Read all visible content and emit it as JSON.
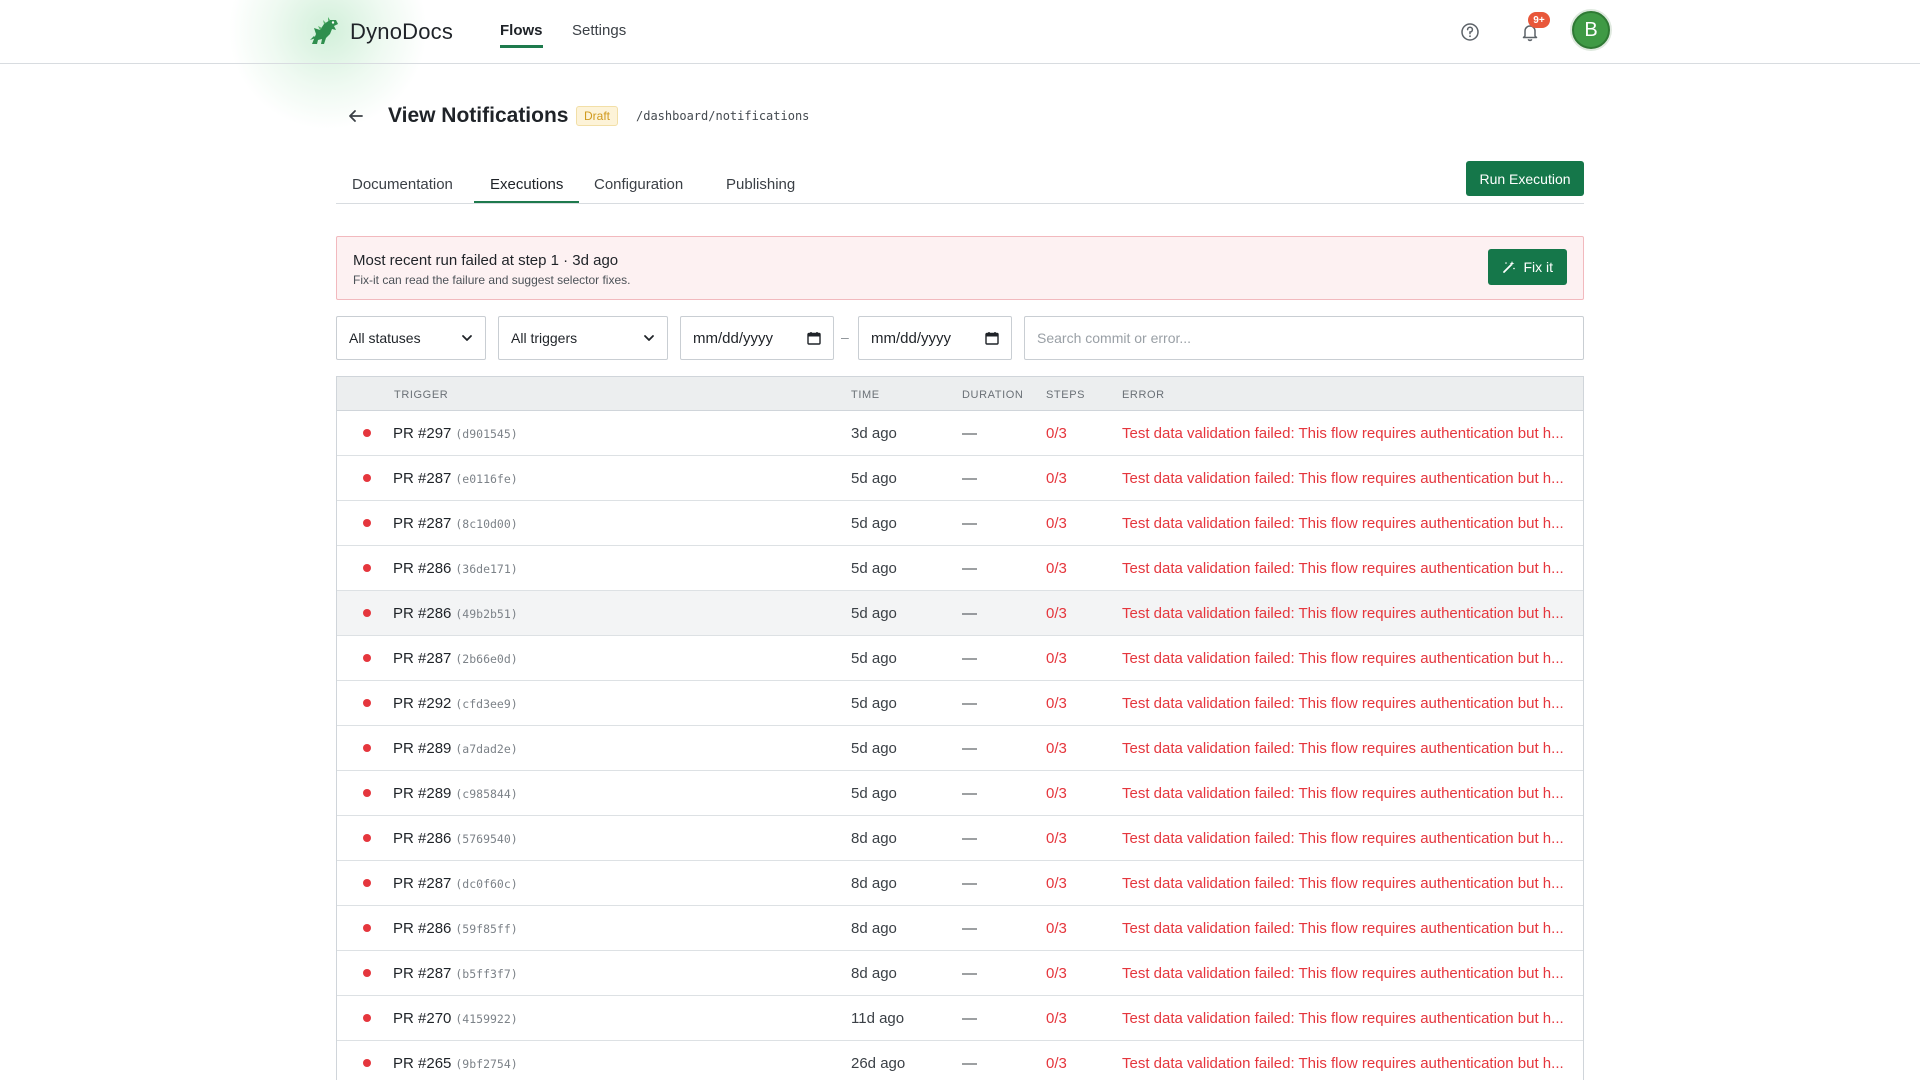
{
  "app": {
    "name": "DynoDocs"
  },
  "nav": {
    "links": [
      "Flows",
      "Settings"
    ],
    "active": "Flows"
  },
  "notifications": {
    "badge": "9+"
  },
  "user": {
    "avatar_initial": "B",
    "avatar_color": "#3f9a45"
  },
  "page": {
    "title": "View Notifications",
    "status": "Draft",
    "path": "/dashboard/notifications"
  },
  "tabs": [
    "Documentation",
    "Executions",
    "Configuration",
    "Publishing"
  ],
  "active_tab": "Executions",
  "actions": {
    "run": "Run Execution"
  },
  "alert": {
    "title": "Most recent run failed at step 1 · 3d ago",
    "subtitle": "Fix-it can read the failure and suggest selector fixes.",
    "button": "Fix it"
  },
  "filters": {
    "status": "All statuses",
    "trigger": "All triggers",
    "date_from": "mm/dd/yyyy",
    "date_to": "mm/dd/yyyy",
    "date_separator": "–",
    "search_placeholder": "Search commit or error..."
  },
  "table": {
    "headers": {
      "trigger": "TRIGGER",
      "time": "TIME",
      "duration": "DURATION",
      "steps": "STEPS",
      "error": "ERROR"
    },
    "rows": [
      {
        "pr": "PR #297",
        "sha": "(d901545)",
        "time": "3d ago",
        "duration": "—",
        "steps": "0/3",
        "error": "Test data validation failed: This flow requires authentication but h...",
        "status": "failed"
      },
      {
        "pr": "PR #287",
        "sha": "(e0116fe)",
        "time": "5d ago",
        "duration": "—",
        "steps": "0/3",
        "error": "Test data validation failed: This flow requires authentication but h...",
        "status": "failed"
      },
      {
        "pr": "PR #287",
        "sha": "(8c10d00)",
        "time": "5d ago",
        "duration": "—",
        "steps": "0/3",
        "error": "Test data validation failed: This flow requires authentication but h...",
        "status": "failed"
      },
      {
        "pr": "PR #286",
        "sha": "(36de171)",
        "time": "5d ago",
        "duration": "—",
        "steps": "0/3",
        "error": "Test data validation failed: This flow requires authentication but h...",
        "status": "failed"
      },
      {
        "pr": "PR #286",
        "sha": "(49b2b51)",
        "time": "5d ago",
        "duration": "—",
        "steps": "0/3",
        "error": "Test data validation failed: This flow requires authentication but h...",
        "status": "failed"
      },
      {
        "pr": "PR #287",
        "sha": "(2b66e0d)",
        "time": "5d ago",
        "duration": "—",
        "steps": "0/3",
        "error": "Test data validation failed: This flow requires authentication but h...",
        "status": "failed"
      },
      {
        "pr": "PR #292",
        "sha": "(cfd3ee9)",
        "time": "5d ago",
        "duration": "—",
        "steps": "0/3",
        "error": "Test data validation failed: This flow requires authentication but h...",
        "status": "failed"
      },
      {
        "pr": "PR #289",
        "sha": "(a7dad2e)",
        "time": "5d ago",
        "duration": "—",
        "steps": "0/3",
        "error": "Test data validation failed: This flow requires authentication but h...",
        "status": "failed"
      },
      {
        "pr": "PR #289",
        "sha": "(c985844)",
        "time": "5d ago",
        "duration": "—",
        "steps": "0/3",
        "error": "Test data validation failed: This flow requires authentication but h...",
        "status": "failed"
      },
      {
        "pr": "PR #286",
        "sha": "(5769540)",
        "time": "8d ago",
        "duration": "—",
        "steps": "0/3",
        "error": "Test data validation failed: This flow requires authentication but h...",
        "status": "failed"
      },
      {
        "pr": "PR #287",
        "sha": "(dc0f60c)",
        "time": "8d ago",
        "duration": "—",
        "steps": "0/3",
        "error": "Test data validation failed: This flow requires authentication but h...",
        "status": "failed"
      },
      {
        "pr": "PR #286",
        "sha": "(59f85ff)",
        "time": "8d ago",
        "duration": "—",
        "steps": "0/3",
        "error": "Test data validation failed: This flow requires authentication but h...",
        "status": "failed"
      },
      {
        "pr": "PR #287",
        "sha": "(b5ff3f7)",
        "time": "8d ago",
        "duration": "—",
        "steps": "0/3",
        "error": "Test data validation failed: This flow requires authentication but h...",
        "status": "failed"
      },
      {
        "pr": "PR #270",
        "sha": "(4159922)",
        "time": "11d ago",
        "duration": "—",
        "steps": "0/3",
        "error": "Test data validation failed: This flow requires authentication but h...",
        "status": "failed"
      },
      {
        "pr": "PR #265",
        "sha": "(9bf2754)",
        "time": "26d ago",
        "duration": "—",
        "steps": "0/3",
        "error": "Test data validation failed: This flow requires authentication but h...",
        "status": "failed"
      }
    ]
  },
  "colors": {
    "primary": "#15774a",
    "error": "#e5363d",
    "warning": "#d09a1e"
  }
}
